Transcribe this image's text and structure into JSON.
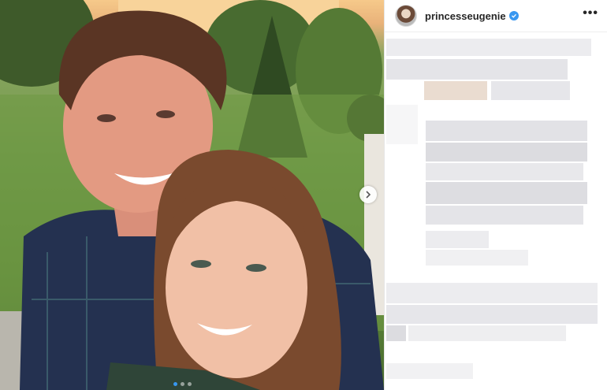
{
  "post": {
    "username": "princesseugenie",
    "more_label": "•••",
    "verified": true,
    "carousel": {
      "slides": 3,
      "active_index": 0
    }
  },
  "icons": {
    "verified": "verified-badge-icon",
    "more": "more-options-icon",
    "next": "chevron-right-icon"
  },
  "colors": {
    "accent": "#3897f0",
    "text": "#262626",
    "border": "#efefef"
  }
}
